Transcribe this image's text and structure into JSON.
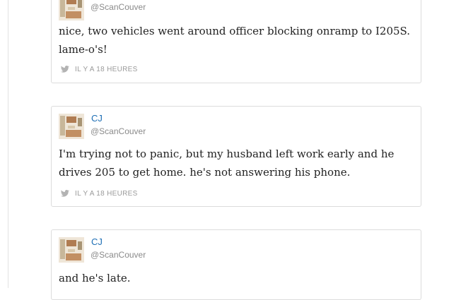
{
  "colors": {
    "author_link": "#1e6fb5",
    "handle": "#8a8a8a",
    "tweet_text": "#222222",
    "meta": "#9a9a9a",
    "card_border": "#dcdcdc"
  },
  "tweets": [
    {
      "author": "",
      "handle": "@ScanCouver",
      "text_lines": [
        "nice, two vehicles went around officer blocking onramp to I205S.",
        "lame-o's!"
      ],
      "timestamp": "IL Y A 18 HEURES",
      "icon": "twitter-bird-icon"
    },
    {
      "author": "CJ",
      "handle": "@ScanCouver",
      "text_lines": [
        "I'm trying not to panic, but my husband left work early and he",
        "drives 205 to get home. he's not answering his phone."
      ],
      "timestamp": "IL Y A 18 HEURES",
      "icon": "twitter-bird-icon"
    },
    {
      "author": "CJ",
      "handle": "@ScanCouver",
      "text_lines": [
        "and he's late."
      ],
      "timestamp": "",
      "icon": "twitter-bird-icon"
    }
  ]
}
